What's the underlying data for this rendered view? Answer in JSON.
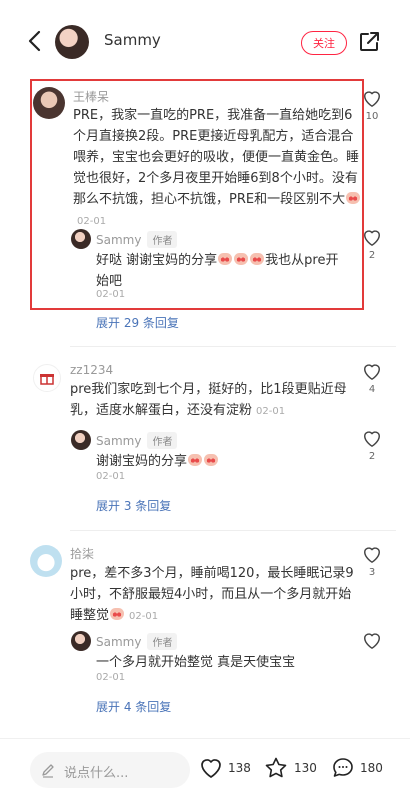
{
  "header": {
    "username": "Sammy",
    "follow_label": "关注"
  },
  "comments": [
    {
      "name": "王棒呆",
      "text": "PRE，我家一直吃的PRE，我准备一直给她吃到6个月直接换2段。PRE更接近母乳配方，适合混合喂养，宝宝也会更好的吸收，便便一直黄金色。睡觉也很好，2个多月夜里开始睡6到8个小时。没有那么不抗饿，担心不抗饿，PRE和一段区别不大",
      "date": "02-01",
      "likes": "10",
      "reply": {
        "name": "Sammy",
        "tag": "作者",
        "text_a": "好哒 谢谢宝妈的分享",
        "text_b": "我也从pre开始吧",
        "date": "02-01",
        "likes": "2"
      },
      "expand": "展开 29 条回复"
    },
    {
      "name": "zz1234",
      "text": "pre我们家吃到七个月，挺好的，比1段更贴近母乳，适度水解蛋白，还没有淀粉",
      "date": "02-01",
      "likes": "4",
      "reply": {
        "name": "Sammy",
        "tag": "作者",
        "text_a": "谢谢宝妈的分享",
        "date": "02-01",
        "likes": "2"
      },
      "expand": "展开 3 条回复"
    },
    {
      "name": "拾柒",
      "text": "pre，差不多3个月，睡前喝120，最长睡眠记录9小时，不舒服最短4小时，而且从一个多月就开始睡整觉",
      "date": "02-01",
      "likes": "3",
      "reply": {
        "name": "Sammy",
        "tag": "作者",
        "text_a": "一个多月就开始整觉 真是天使宝宝",
        "date": "02-01"
      },
      "expand": "展开 4 条回复"
    }
  ],
  "bottom_bar": {
    "input_placeholder": "说点什么...",
    "likes": "138",
    "stars": "130",
    "comments": "180"
  },
  "colors": {
    "accent": "#ff2442",
    "link": "#4a74b8",
    "highlight_border": "#e23a3a"
  }
}
